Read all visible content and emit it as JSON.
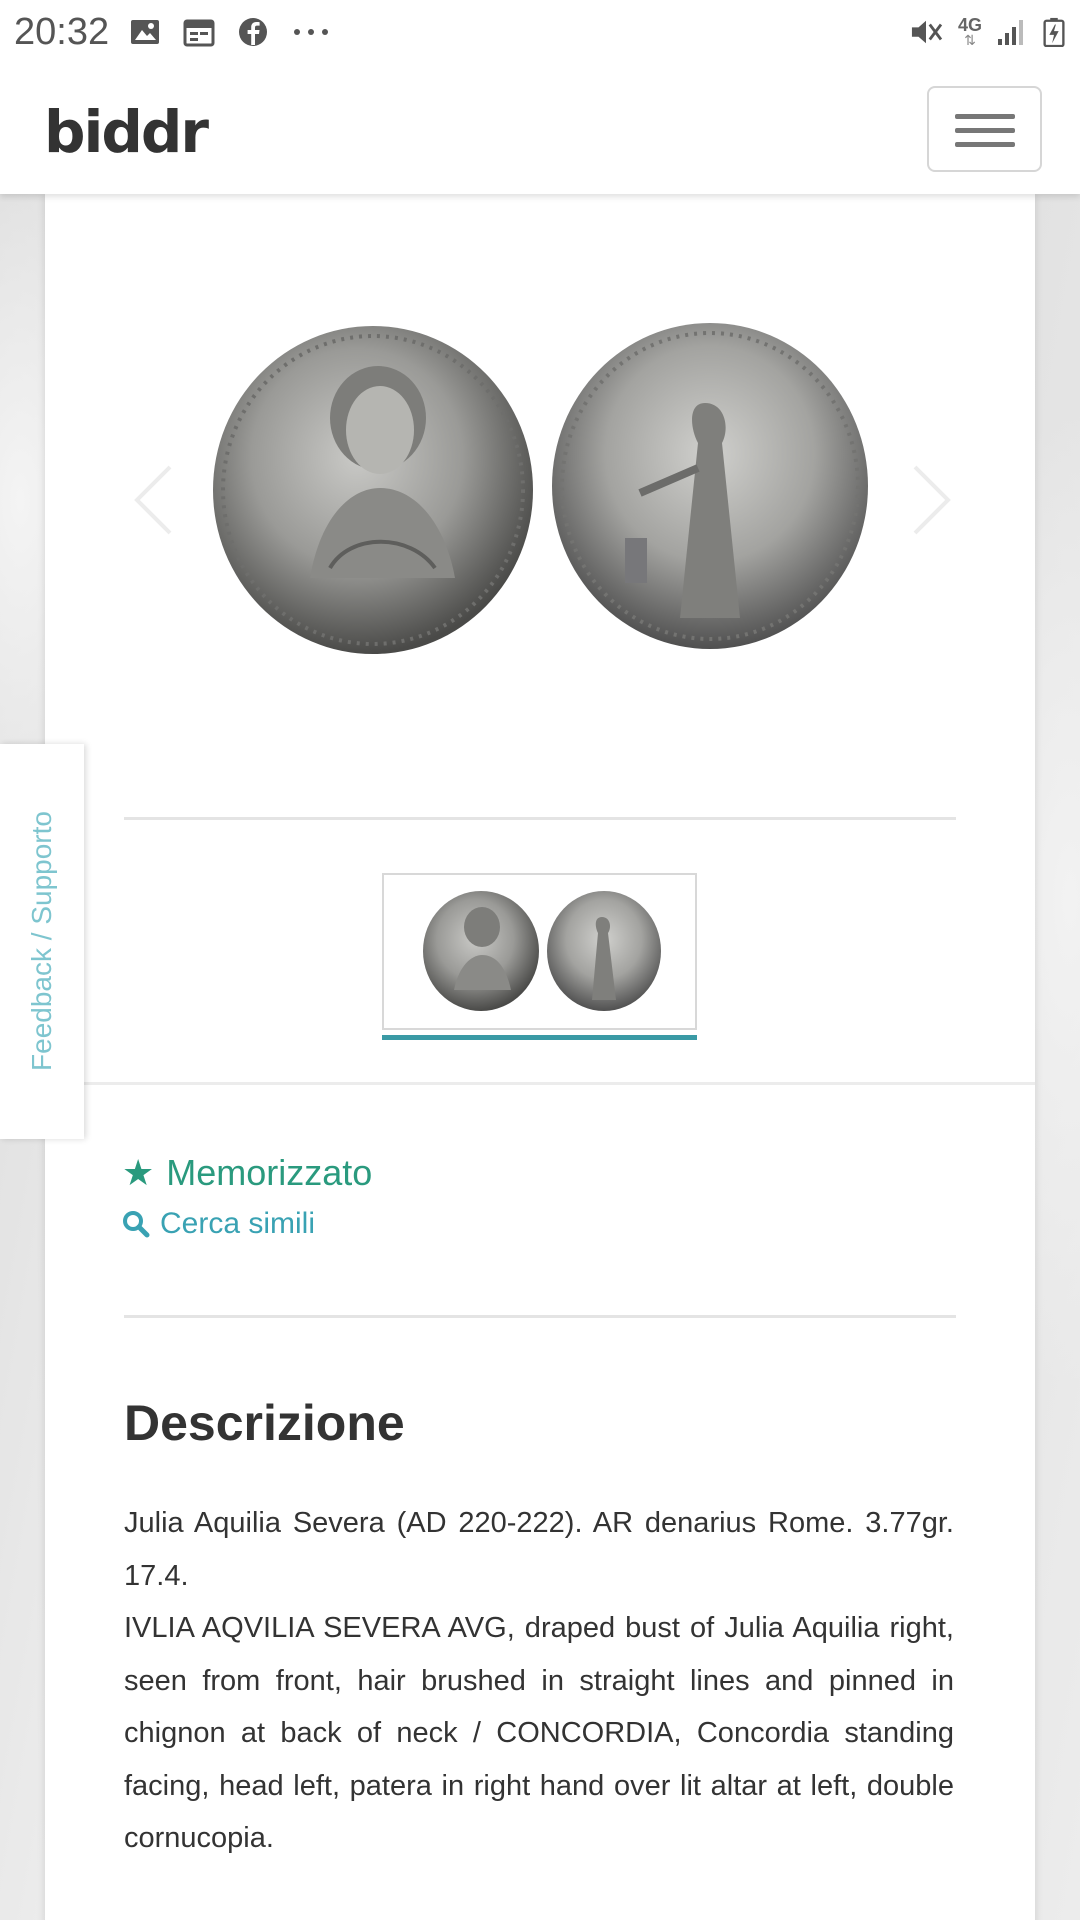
{
  "status_bar": {
    "time": "20:32",
    "network": "4G",
    "left_icons": [
      "image-icon",
      "calendar-icon",
      "facebook-icon",
      "more-icon"
    ],
    "right_icons": [
      "mute-icon",
      "signal-icon",
      "battery-icon"
    ]
  },
  "header": {
    "logo": "biddr",
    "menu_icon": "hamburger-menu-icon"
  },
  "carousel": {
    "prev_icon": "chevron-left-icon",
    "next_icon": "chevron-right-icon",
    "images": [
      "coin-obverse",
      "coin-reverse"
    ]
  },
  "feedback_tab": {
    "label": "Feedback / Supporto"
  },
  "actions": {
    "saved_label": "Memorizzato",
    "similar_label": "Cerca simili"
  },
  "description": {
    "title": "Descrizione",
    "line1": "Julia Aquilia Severa (AD 220-222). AR denarius Rome. 3.77gr. 17.4.",
    "line2": "IVLIA AQVILIA SEVERA AVG, draped bust of Julia Aquilia right, seen from front, hair brushed in straight lines and pinned in chignon at back of neck / CONCORDIA, Concordia standing facing, head left, patera in right hand over lit altar at left, double cornucopia."
  },
  "colors": {
    "accent_green": "#2a9a7e",
    "accent_teal": "#39a2b3",
    "thumb_underline": "#3a9aa5"
  }
}
